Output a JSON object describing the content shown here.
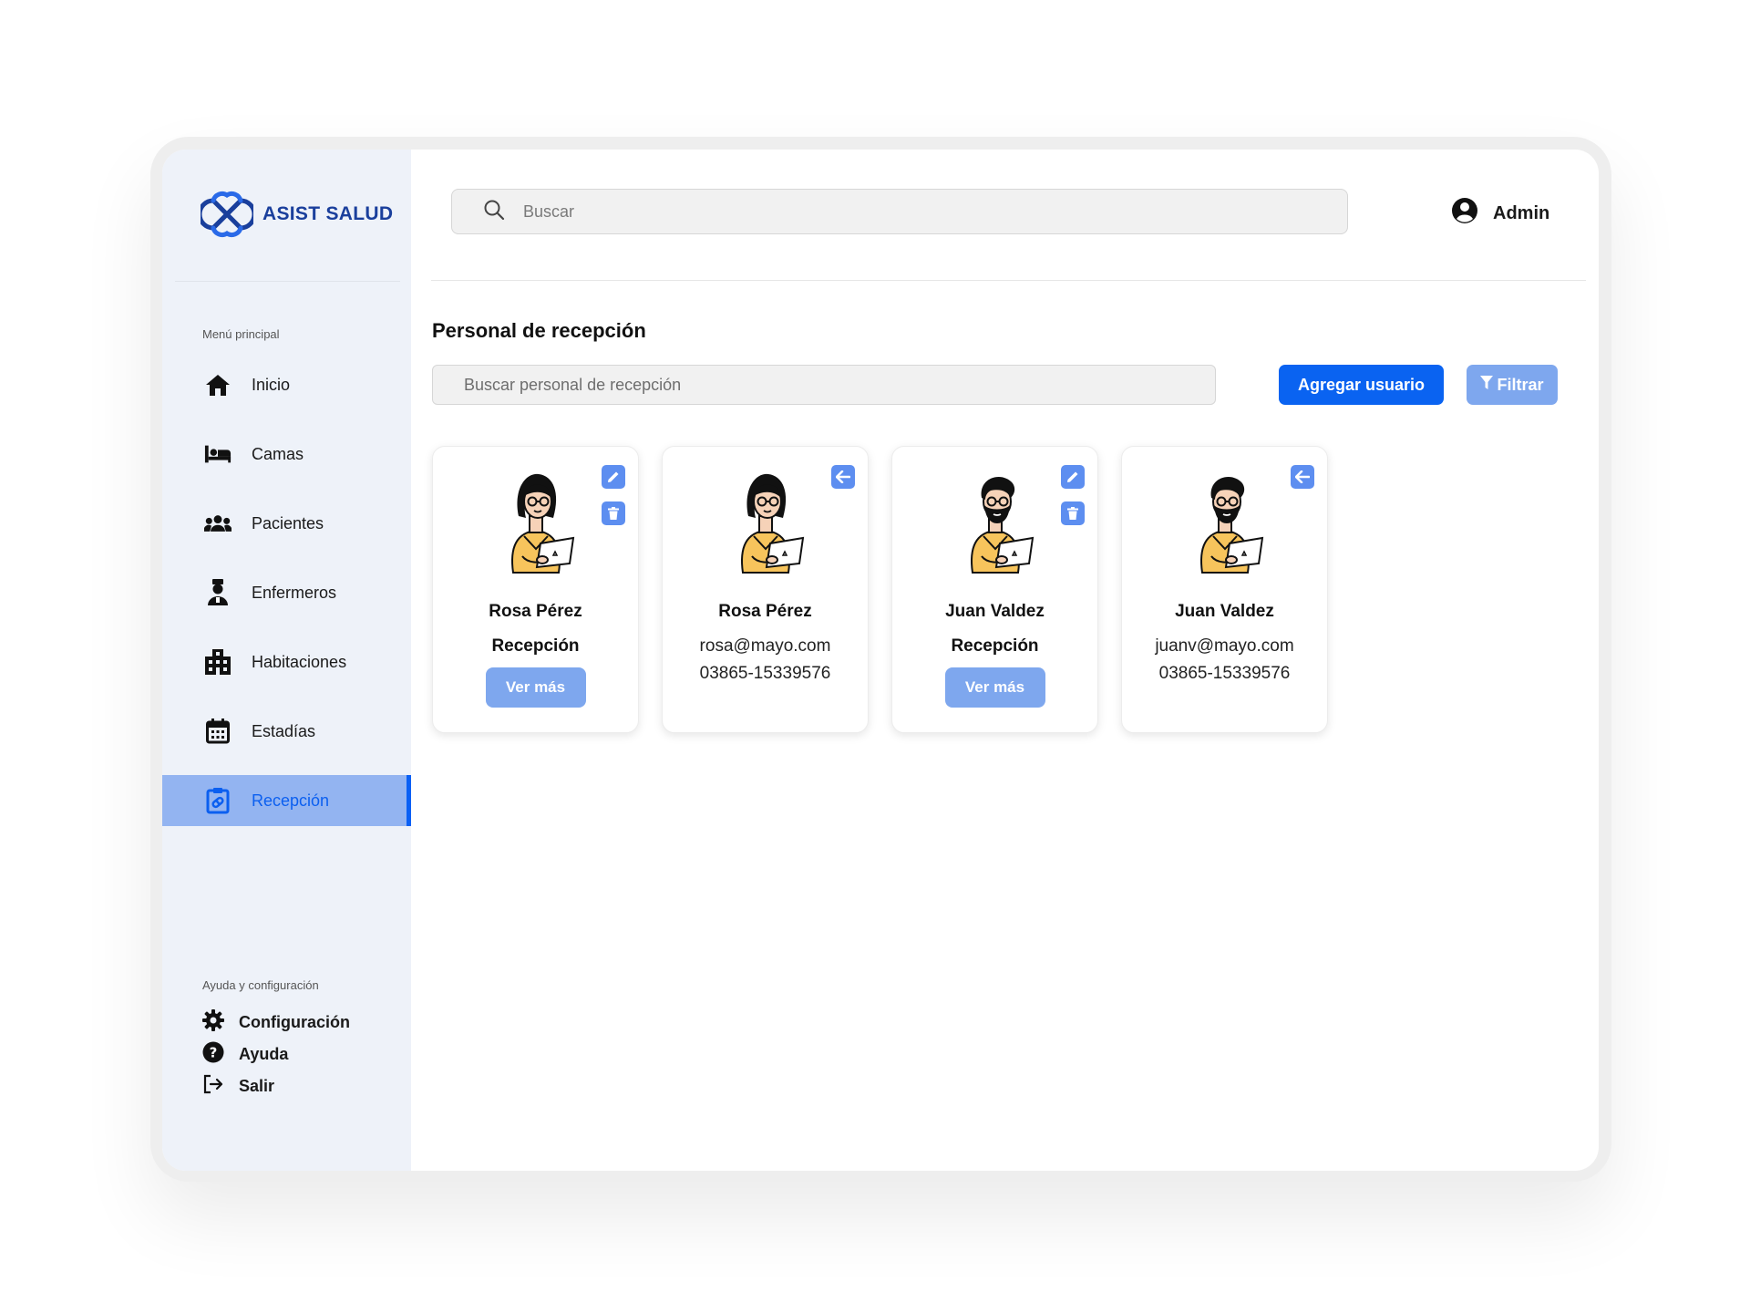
{
  "brand": {
    "name": "ASIST SALUD",
    "color": "#1a3f9c"
  },
  "colors": {
    "primary": "#0a63f1",
    "soft_blue": "#7ea7ee",
    "sidebar_bg": "#eef2f9",
    "active_bg": "#93b4f1"
  },
  "search": {
    "placeholder": "Buscar"
  },
  "user": {
    "name": "Admin",
    "icon": "user-circle-icon"
  },
  "sidebar": {
    "main_menu_label": "Menú principal",
    "items": [
      {
        "label": "Inicio",
        "icon": "home-icon"
      },
      {
        "label": "Camas",
        "icon": "bed-icon"
      },
      {
        "label": "Pacientes",
        "icon": "users-icon"
      },
      {
        "label": "Enfermeros",
        "icon": "nurse-icon"
      },
      {
        "label": "Habitaciones",
        "icon": "building-icon"
      },
      {
        "label": "Estadías",
        "icon": "calendar-icon"
      },
      {
        "label": "Recepción",
        "icon": "clipboard-icon",
        "active": true
      }
    ],
    "help_label": "Ayuda y configuración",
    "help_items": [
      {
        "label": "Configuración",
        "icon": "gear-icon"
      },
      {
        "label": "Ayuda",
        "icon": "question-icon"
      },
      {
        "label": "Salir",
        "icon": "logout-icon"
      }
    ]
  },
  "page": {
    "title": "Personal de recepción",
    "search_placeholder": "Buscar personal de recepción",
    "add_button": "Agregar usuario",
    "filter_button": "Filtrar"
  },
  "cards": [
    {
      "name": "Rosa Pérez",
      "role": "Recepción",
      "more_label": "Ver más",
      "avatar": "woman-laptop-avatar",
      "actions": [
        "edit-icon",
        "trash-icon"
      ]
    },
    {
      "name": "Rosa Pérez",
      "email": "rosa@mayo.com",
      "phone": "03865-15339576",
      "avatar": "woman-laptop-avatar",
      "actions": [
        "back-arrow-icon"
      ]
    },
    {
      "name": "Juan Valdez",
      "role": "Recepción",
      "more_label": "Ver más",
      "avatar": "man-laptop-avatar",
      "actions": [
        "edit-icon",
        "trash-icon"
      ]
    },
    {
      "name": "Juan Valdez",
      "email": "juanv@mayo.com",
      "phone": "03865-15339576",
      "avatar": "man-laptop-avatar",
      "actions": [
        "back-arrow-icon"
      ]
    }
  ]
}
